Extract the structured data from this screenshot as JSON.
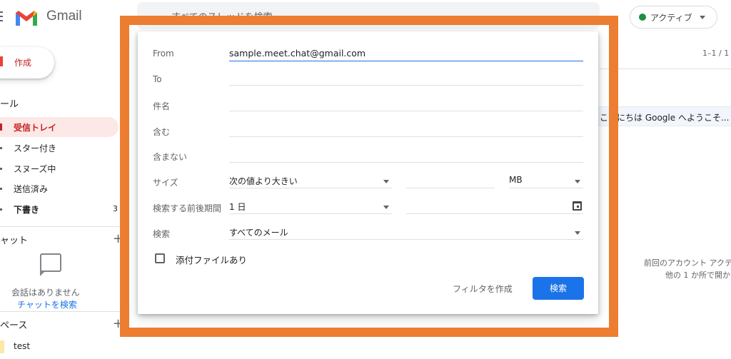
{
  "app": {
    "name": "Gmail"
  },
  "header": {
    "search_placeholder": "すべてのスレッドを検索",
    "status_label": "アクティブ"
  },
  "sidebar": {
    "compose_label": "作成",
    "mail_section": "ール",
    "items": [
      {
        "label": "受信トレイ"
      },
      {
        "label": "スター付き"
      },
      {
        "label": "スヌーズ中"
      },
      {
        "label": "送信済み"
      },
      {
        "label": "下書き",
        "count": "3"
      }
    ],
    "chat_section": "ャット",
    "no_chat": "会話はありません",
    "find_chat": "チャットを検索",
    "spaces_section": "ペース",
    "space_item": "test"
  },
  "main": {
    "page_count": "1–1 / 1",
    "welcome_row": "こんにちは Google へようこそ...",
    "activity_line1": "前回のアカウント アクテ",
    "activity_line2": "他の 1 か所で開か"
  },
  "dialog": {
    "from_label": "From",
    "from_value": "sample.meet.chat@gmail.com",
    "to_label": "To",
    "subject_label": "件名",
    "has_words_label": "含む",
    "no_words_label": "含まない",
    "size_label": "サイズ",
    "size_operator": "次の値より大きい",
    "size_unit": "MB",
    "date_label": "検索する前後期間",
    "date_value": "1 日",
    "search_in_label": "検索",
    "search_in_value": "すべてのメール",
    "attachment_label": "添付ファイルあり",
    "create_filter_label": "フィルタを作成",
    "search_button_label": "検索"
  },
  "colors": {
    "highlight": "#ed7d31",
    "primary": "#1a73e8",
    "inbox_active": "#c5221f"
  }
}
